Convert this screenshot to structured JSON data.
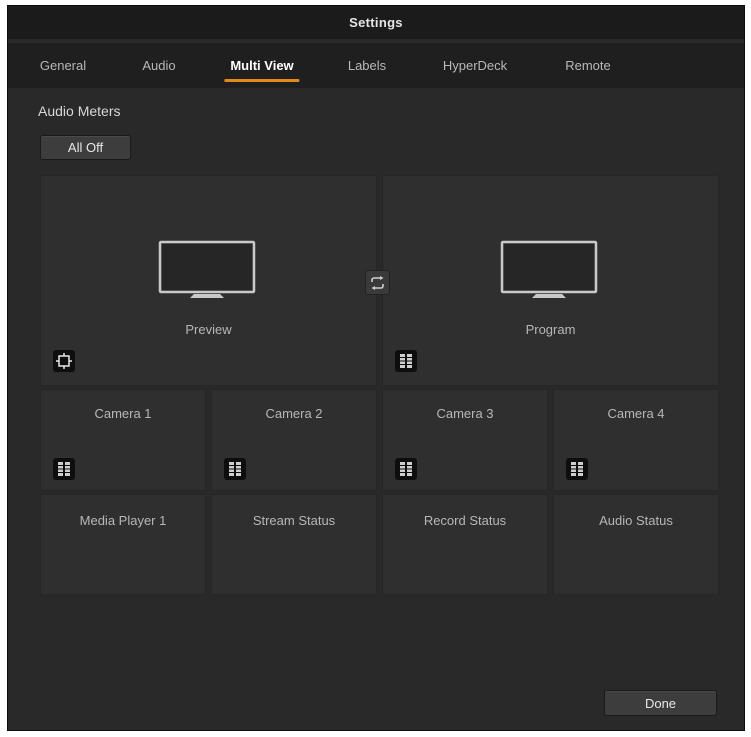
{
  "window": {
    "title": "Settings"
  },
  "tabs": [
    {
      "label": "General",
      "active": false
    },
    {
      "label": "Audio",
      "active": false
    },
    {
      "label": "Multi View",
      "active": true
    },
    {
      "label": "Labels",
      "active": false
    },
    {
      "label": "HyperDeck",
      "active": false
    },
    {
      "label": "Remote",
      "active": false
    }
  ],
  "audio_meters": {
    "section_label": "Audio Meters",
    "all_off_label": "All Off"
  },
  "multiview": {
    "large": [
      {
        "label": "Preview",
        "badge_icon": "safe-area-icon"
      },
      {
        "label": "Program",
        "badge_icon": "audio-meter-icon"
      }
    ],
    "row1": [
      {
        "label": "Camera 1",
        "badge_icon": "audio-meter-icon"
      },
      {
        "label": "Camera 2",
        "badge_icon": "audio-meter-icon"
      },
      {
        "label": "Camera 3",
        "badge_icon": "audio-meter-icon"
      },
      {
        "label": "Camera 4",
        "badge_icon": "audio-meter-icon"
      }
    ],
    "row2": [
      {
        "label": "Media Player 1"
      },
      {
        "label": "Stream Status"
      },
      {
        "label": "Record Status"
      },
      {
        "label": "Audio Status"
      }
    ],
    "swap_icon": "swap-icon"
  },
  "footer": {
    "done_label": "Done"
  },
  "colors": {
    "accent": "#e08a1a",
    "background": "#292929",
    "cell": "#2f2f2f"
  }
}
